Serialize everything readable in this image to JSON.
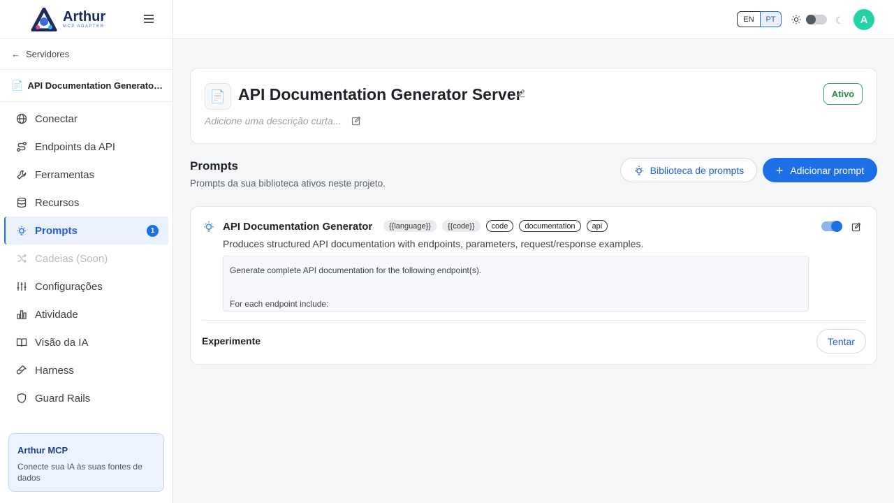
{
  "brand": {
    "name": "Arthur",
    "subtitle": "MCP ADAPTER"
  },
  "sidebar": {
    "back_label": "Servidores",
    "server_name": "API Documentation Generator Server",
    "items": [
      {
        "label": "Conectar",
        "icon": "globe-icon"
      },
      {
        "label": "Endpoints da API",
        "icon": "route-icon"
      },
      {
        "label": "Ferramentas",
        "icon": "wrench-icon"
      },
      {
        "label": "Recursos",
        "icon": "database-icon"
      },
      {
        "label": "Prompts",
        "icon": "bulb-icon",
        "badge": "1",
        "active": true
      },
      {
        "label": "Cadeias (Soon)",
        "icon": "shuffle-icon",
        "disabled": true
      },
      {
        "label": "Configurações",
        "icon": "sliders-icon"
      },
      {
        "label": "Atividade",
        "icon": "bar-chart-icon"
      },
      {
        "label": "Visão da IA",
        "icon": "book-icon"
      },
      {
        "label": "Harness",
        "icon": "test-tube-icon"
      },
      {
        "label": "Guard Rails",
        "icon": "shield-icon"
      }
    ],
    "promo": {
      "title": "Arthur MCP",
      "text": "Conecte sua IA às suas fontes de dados"
    }
  },
  "topbar": {
    "lang_en": "EN",
    "lang_pt": "PT",
    "avatar_initial": "A"
  },
  "server": {
    "title": "API Documentation Generator Server",
    "description_placeholder": "Adicione uma descrição curta...",
    "status": "Ativo"
  },
  "prompts_section": {
    "title": "Prompts",
    "subtitle": "Prompts da sua biblioteca ativos neste projeto.",
    "library_button": "Biblioteca de prompts",
    "add_button": "Adicionar prompt"
  },
  "prompt": {
    "title": "API Documentation Generator",
    "tags": [
      {
        "text": "{{language}}",
        "kind": "var"
      },
      {
        "text": "{{code}}",
        "kind": "var"
      },
      {
        "text": "code",
        "kind": "kw"
      },
      {
        "text": "documentation",
        "kind": "kw"
      },
      {
        "text": "api",
        "kind": "kw"
      }
    ],
    "description": "Produces structured API documentation with endpoints, parameters, request/response examples.",
    "template_lines": [
      "Generate complete API documentation for the following endpoint(s).",
      "For each endpoint include:"
    ],
    "enabled": true,
    "try_label": "Experimente",
    "try_button": "Tentar"
  }
}
